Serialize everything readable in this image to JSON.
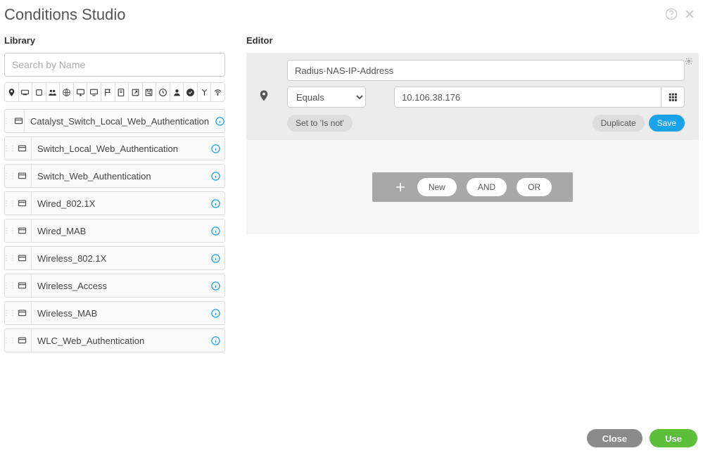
{
  "title": "Conditions Studio",
  "library": {
    "title": "Library",
    "search_placeholder": "Search by Name",
    "items": [
      {
        "label": "Catalyst_Switch_Local_Web_Authentication"
      },
      {
        "label": "Switch_Local_Web_Authentication"
      },
      {
        "label": "Switch_Web_Authentication"
      },
      {
        "label": "Wired_802.1X"
      },
      {
        "label": "Wired_MAB"
      },
      {
        "label": "Wireless_802.1X"
      },
      {
        "label": "Wireless_Access"
      },
      {
        "label": "Wireless_MAB"
      },
      {
        "label": "WLC_Web_Authentication"
      }
    ]
  },
  "editor": {
    "title": "Editor",
    "attribute": "Radius·NAS-IP-Address",
    "operator": "Equals",
    "value": "10.106.38.176",
    "set_isnot": "Set to 'Is not'",
    "duplicate": "Duplicate",
    "save": "Save",
    "logic": {
      "new": "New",
      "and": "AND",
      "or": "OR"
    }
  },
  "footer": {
    "close": "Close",
    "use": "Use"
  }
}
